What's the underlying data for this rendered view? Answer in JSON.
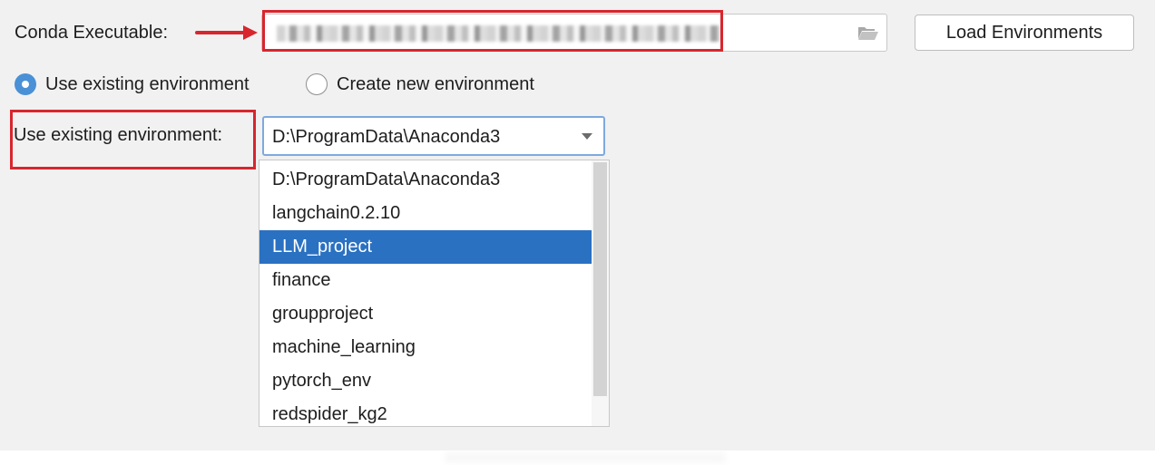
{
  "conda": {
    "label": "Conda Executable:",
    "path_value": ""
  },
  "load_button": "Load Environments",
  "radios": [
    {
      "label": "Use existing environment",
      "checked": true
    },
    {
      "label": "Create new environment",
      "checked": false
    }
  ],
  "env": {
    "label": "Use existing environment:",
    "selected": "D:\\ProgramData\\Anaconda3"
  },
  "dropdown": {
    "items": [
      "D:\\ProgramData\\Anaconda3",
      "langchain0.2.10",
      "LLM_project",
      "finance",
      "groupproject",
      "machine_learning",
      "pytorch_env",
      "redspider_kg2"
    ],
    "highlighted_index": 2
  },
  "icons": {
    "folder": "folder-open-icon",
    "arrow": "arrow-right-icon",
    "caret": "chevron-down-icon"
  },
  "colors": {
    "annotation_red": "#d8262e",
    "accent_blue": "#4a90d6",
    "selection_blue": "#2a71c2",
    "panel_bg": "#f1f1f1"
  }
}
